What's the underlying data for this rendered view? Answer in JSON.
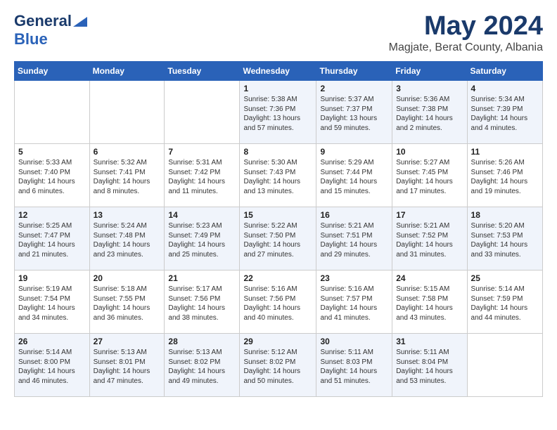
{
  "header": {
    "logo_line1": "General",
    "logo_line2": "Blue",
    "month": "May 2024",
    "location": "Magjate, Berat County, Albania"
  },
  "weekdays": [
    "Sunday",
    "Monday",
    "Tuesday",
    "Wednesday",
    "Thursday",
    "Friday",
    "Saturday"
  ],
  "weeks": [
    [
      {
        "day": "",
        "sunrise": "",
        "sunset": "",
        "daylight": ""
      },
      {
        "day": "",
        "sunrise": "",
        "sunset": "",
        "daylight": ""
      },
      {
        "day": "",
        "sunrise": "",
        "sunset": "",
        "daylight": ""
      },
      {
        "day": "1",
        "sunrise": "Sunrise: 5:38 AM",
        "sunset": "Sunset: 7:36 PM",
        "daylight": "Daylight: 13 hours and 57 minutes."
      },
      {
        "day": "2",
        "sunrise": "Sunrise: 5:37 AM",
        "sunset": "Sunset: 7:37 PM",
        "daylight": "Daylight: 13 hours and 59 minutes."
      },
      {
        "day": "3",
        "sunrise": "Sunrise: 5:36 AM",
        "sunset": "Sunset: 7:38 PM",
        "daylight": "Daylight: 14 hours and 2 minutes."
      },
      {
        "day": "4",
        "sunrise": "Sunrise: 5:34 AM",
        "sunset": "Sunset: 7:39 PM",
        "daylight": "Daylight: 14 hours and 4 minutes."
      }
    ],
    [
      {
        "day": "5",
        "sunrise": "Sunrise: 5:33 AM",
        "sunset": "Sunset: 7:40 PM",
        "daylight": "Daylight: 14 hours and 6 minutes."
      },
      {
        "day": "6",
        "sunrise": "Sunrise: 5:32 AM",
        "sunset": "Sunset: 7:41 PM",
        "daylight": "Daylight: 14 hours and 8 minutes."
      },
      {
        "day": "7",
        "sunrise": "Sunrise: 5:31 AM",
        "sunset": "Sunset: 7:42 PM",
        "daylight": "Daylight: 14 hours and 11 minutes."
      },
      {
        "day": "8",
        "sunrise": "Sunrise: 5:30 AM",
        "sunset": "Sunset: 7:43 PM",
        "daylight": "Daylight: 14 hours and 13 minutes."
      },
      {
        "day": "9",
        "sunrise": "Sunrise: 5:29 AM",
        "sunset": "Sunset: 7:44 PM",
        "daylight": "Daylight: 14 hours and 15 minutes."
      },
      {
        "day": "10",
        "sunrise": "Sunrise: 5:27 AM",
        "sunset": "Sunset: 7:45 PM",
        "daylight": "Daylight: 14 hours and 17 minutes."
      },
      {
        "day": "11",
        "sunrise": "Sunrise: 5:26 AM",
        "sunset": "Sunset: 7:46 PM",
        "daylight": "Daylight: 14 hours and 19 minutes."
      }
    ],
    [
      {
        "day": "12",
        "sunrise": "Sunrise: 5:25 AM",
        "sunset": "Sunset: 7:47 PM",
        "daylight": "Daylight: 14 hours and 21 minutes."
      },
      {
        "day": "13",
        "sunrise": "Sunrise: 5:24 AM",
        "sunset": "Sunset: 7:48 PM",
        "daylight": "Daylight: 14 hours and 23 minutes."
      },
      {
        "day": "14",
        "sunrise": "Sunrise: 5:23 AM",
        "sunset": "Sunset: 7:49 PM",
        "daylight": "Daylight: 14 hours and 25 minutes."
      },
      {
        "day": "15",
        "sunrise": "Sunrise: 5:22 AM",
        "sunset": "Sunset: 7:50 PM",
        "daylight": "Daylight: 14 hours and 27 minutes."
      },
      {
        "day": "16",
        "sunrise": "Sunrise: 5:21 AM",
        "sunset": "Sunset: 7:51 PM",
        "daylight": "Daylight: 14 hours and 29 minutes."
      },
      {
        "day": "17",
        "sunrise": "Sunrise: 5:21 AM",
        "sunset": "Sunset: 7:52 PM",
        "daylight": "Daylight: 14 hours and 31 minutes."
      },
      {
        "day": "18",
        "sunrise": "Sunrise: 5:20 AM",
        "sunset": "Sunset: 7:53 PM",
        "daylight": "Daylight: 14 hours and 33 minutes."
      }
    ],
    [
      {
        "day": "19",
        "sunrise": "Sunrise: 5:19 AM",
        "sunset": "Sunset: 7:54 PM",
        "daylight": "Daylight: 14 hours and 34 minutes."
      },
      {
        "day": "20",
        "sunrise": "Sunrise: 5:18 AM",
        "sunset": "Sunset: 7:55 PM",
        "daylight": "Daylight: 14 hours and 36 minutes."
      },
      {
        "day": "21",
        "sunrise": "Sunrise: 5:17 AM",
        "sunset": "Sunset: 7:56 PM",
        "daylight": "Daylight: 14 hours and 38 minutes."
      },
      {
        "day": "22",
        "sunrise": "Sunrise: 5:16 AM",
        "sunset": "Sunset: 7:56 PM",
        "daylight": "Daylight: 14 hours and 40 minutes."
      },
      {
        "day": "23",
        "sunrise": "Sunrise: 5:16 AM",
        "sunset": "Sunset: 7:57 PM",
        "daylight": "Daylight: 14 hours and 41 minutes."
      },
      {
        "day": "24",
        "sunrise": "Sunrise: 5:15 AM",
        "sunset": "Sunset: 7:58 PM",
        "daylight": "Daylight: 14 hours and 43 minutes."
      },
      {
        "day": "25",
        "sunrise": "Sunrise: 5:14 AM",
        "sunset": "Sunset: 7:59 PM",
        "daylight": "Daylight: 14 hours and 44 minutes."
      }
    ],
    [
      {
        "day": "26",
        "sunrise": "Sunrise: 5:14 AM",
        "sunset": "Sunset: 8:00 PM",
        "daylight": "Daylight: 14 hours and 46 minutes."
      },
      {
        "day": "27",
        "sunrise": "Sunrise: 5:13 AM",
        "sunset": "Sunset: 8:01 PM",
        "daylight": "Daylight: 14 hours and 47 minutes."
      },
      {
        "day": "28",
        "sunrise": "Sunrise: 5:13 AM",
        "sunset": "Sunset: 8:02 PM",
        "daylight": "Daylight: 14 hours and 49 minutes."
      },
      {
        "day": "29",
        "sunrise": "Sunrise: 5:12 AM",
        "sunset": "Sunset: 8:02 PM",
        "daylight": "Daylight: 14 hours and 50 minutes."
      },
      {
        "day": "30",
        "sunrise": "Sunrise: 5:11 AM",
        "sunset": "Sunset: 8:03 PM",
        "daylight": "Daylight: 14 hours and 51 minutes."
      },
      {
        "day": "31",
        "sunrise": "Sunrise: 5:11 AM",
        "sunset": "Sunset: 8:04 PM",
        "daylight": "Daylight: 14 hours and 53 minutes."
      },
      {
        "day": "",
        "sunrise": "",
        "sunset": "",
        "daylight": ""
      }
    ]
  ]
}
